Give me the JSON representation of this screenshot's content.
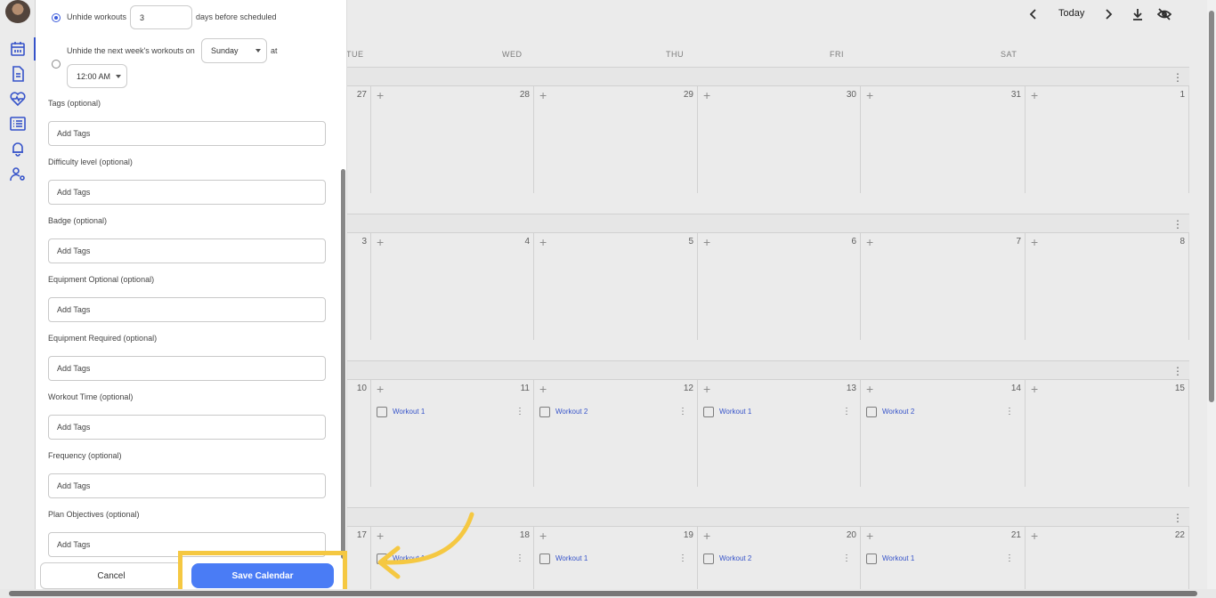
{
  "colors": {
    "accent": "#3b5bdb",
    "save_button": "#4a7cf5",
    "highlight": "#f5c842"
  },
  "left_nav": {
    "icons": [
      "calendar-icon",
      "document-icon",
      "heart-pulse-icon",
      "list-icon",
      "bell-icon",
      "user-settings-icon"
    ]
  },
  "toolbar": {
    "prev": "‹",
    "today_label": "Today",
    "next": "›",
    "download_icon": "download-icon",
    "hide_icon": "eye-off-icon"
  },
  "day_headers": [
    "TUE",
    "WED",
    "THU",
    "FRI",
    "SAT"
  ],
  "weeks": [
    {
      "days": [
        "27",
        "28",
        "29",
        "30",
        "31",
        "1"
      ]
    },
    {
      "days": [
        "3",
        "4",
        "5",
        "6",
        "7",
        "8"
      ]
    },
    {
      "days": [
        "10",
        "11",
        "12",
        "13",
        "14",
        "15"
      ],
      "workouts": [
        "Workout 1",
        "Workout 2",
        "Workout 1",
        "Workout 2"
      ]
    },
    {
      "days": [
        "17",
        "18",
        "19",
        "20",
        "21",
        "22"
      ],
      "workouts": [
        "Workout 1",
        "Workout 1",
        "Workout 2",
        "Workout 1"
      ]
    }
  ],
  "form": {
    "unhide_workouts_label": "Unhide workouts",
    "unhide_days_value": "3",
    "unhide_days_suffix": "days before scheduled",
    "unhide_next_week_label": "Unhide the next week's workouts on",
    "weekday_value": "Sunday",
    "at_label": "at",
    "time_value": "12:00 AM",
    "fields": [
      {
        "label": "Tags (optional)",
        "placeholder": "Add Tags"
      },
      {
        "label": "Difficulty level (optional)",
        "placeholder": "Add Tags"
      },
      {
        "label": "Badge (optional)",
        "placeholder": "Add Tags"
      },
      {
        "label": "Equipment Optional (optional)",
        "placeholder": "Add Tags"
      },
      {
        "label": "Equipment Required (optional)",
        "placeholder": "Add Tags"
      },
      {
        "label": "Workout Time (optional)",
        "placeholder": "Add Tags"
      },
      {
        "label": "Frequency (optional)",
        "placeholder": "Add Tags"
      },
      {
        "label": "Plan Objectives (optional)",
        "placeholder": "Add Tags"
      }
    ],
    "cancel_label": "Cancel",
    "save_label": "Save Calendar"
  }
}
